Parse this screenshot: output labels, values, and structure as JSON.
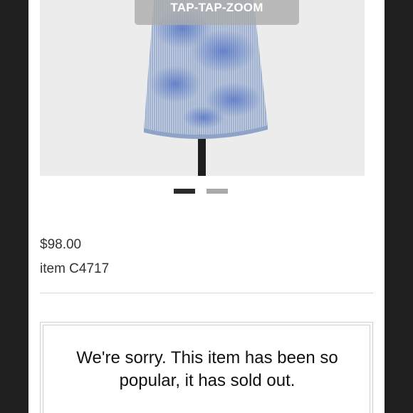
{
  "product": {
    "zoom_hint": "TAP-TAP-ZOOM",
    "price": "$98.00",
    "item_number": "item C4717",
    "sold_out_message_line1": "We're sorry. This item has been so",
    "sold_out_message_line2": "popular, it has sold out."
  },
  "gallery": {
    "image_count": 2,
    "active_index": 0,
    "image_alt": "blue tie-dye striped skirt on mannequin stand"
  },
  "colors": {
    "frame_background": "#1f1f1f",
    "page_background": "#ffffff",
    "pager_active": "#2b2b2b",
    "pager_inactive": "#a9a9a9",
    "text": "#333333"
  }
}
